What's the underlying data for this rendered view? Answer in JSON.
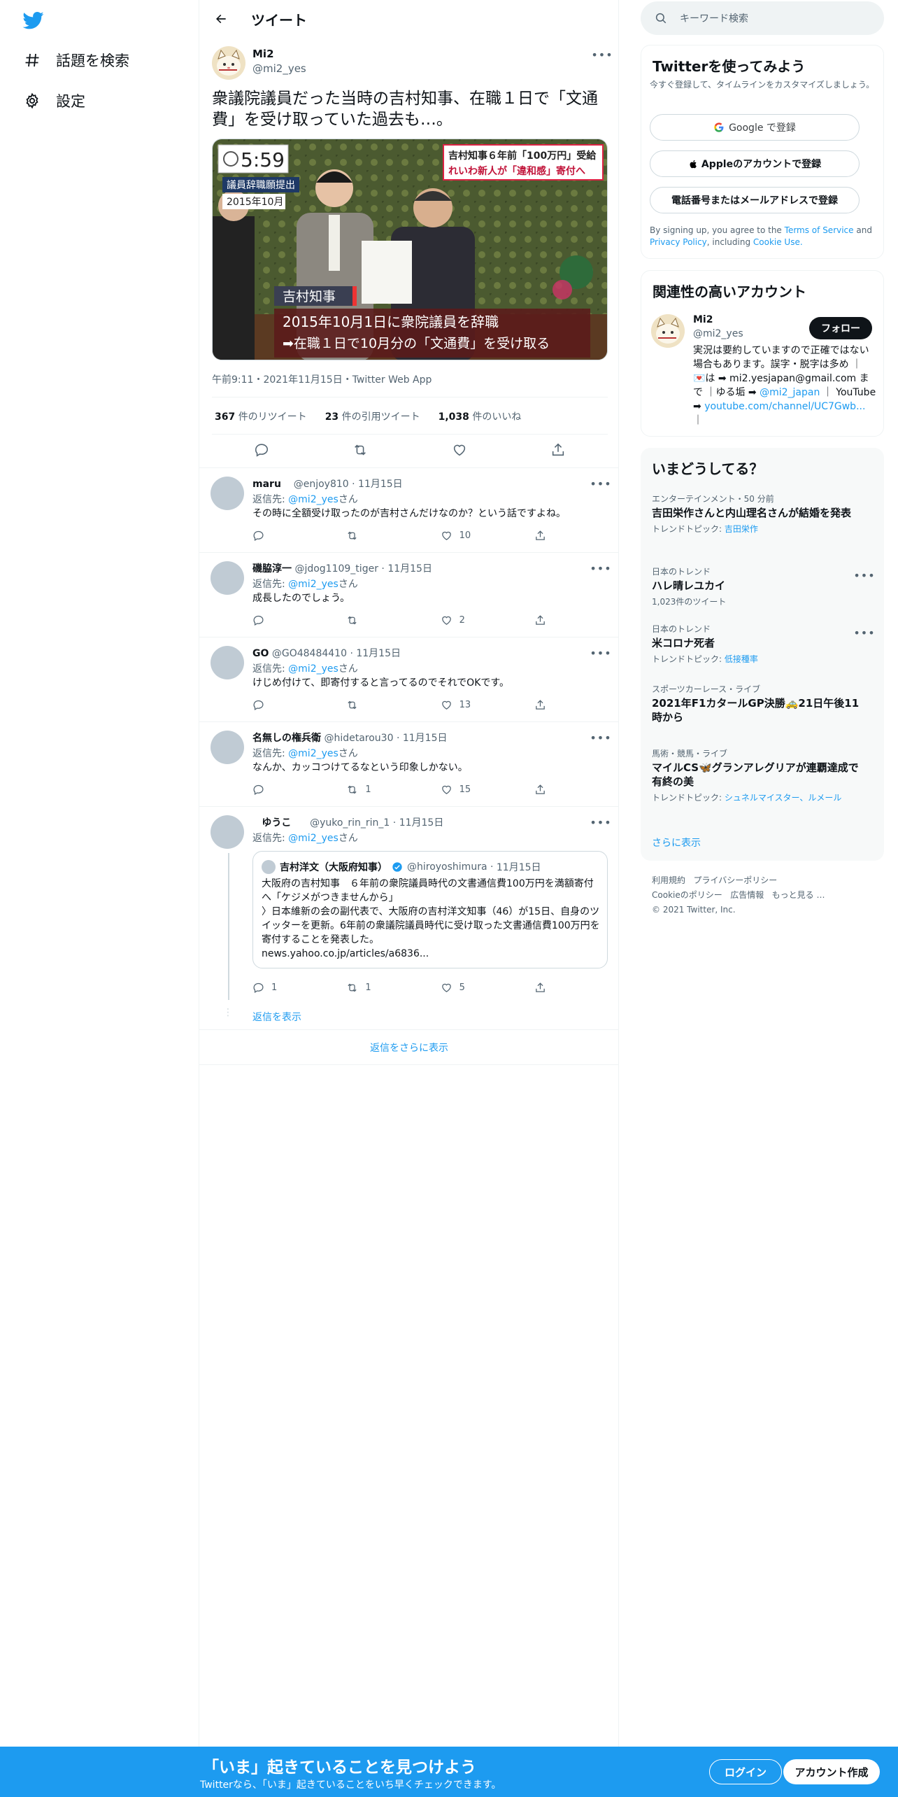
{
  "nav": {
    "explore_label": "話題を検索",
    "settings_label": "設定"
  },
  "header": {
    "title": "ツイート"
  },
  "tweet": {
    "name": "Mi2",
    "handle": "@mi2_yes",
    "text": "衆議院議員だった当時の吉村知事、在職１日で「文通費」を受け取っていた過去も…。",
    "image": {
      "clock": "5:59",
      "tag1": "議員辞職願提出",
      "tag2": "2015年10月",
      "headline1": "吉村知事６年前「100万円」受給",
      "headline2": "れいわ新人が「違和感」寄付へ",
      "name_caption": "吉村知事",
      "caption1": "2015年10月1日に衆院議員を辞職",
      "caption2": "➡在職１日で10月分の「文通費」を受け取る"
    },
    "meta": "午前9:11・2021年11月15日・Twitter Web App",
    "retweets": "367",
    "retweets_label": "件のリツイート",
    "quotes": "23",
    "quotes_label": "件の引用ツイート",
    "likes": "1,038",
    "likes_label": "件のいいね"
  },
  "reply_to_label": "返信先:",
  "reply_to_user": "@mi2_yes",
  "reply_to_suffix": "さん",
  "replies": [
    {
      "name": "maru",
      "handle": "@enjoy810",
      "date": "11月15日",
      "text": "その時に全額受け取ったのが吉村さんだけなのか？という話ですよね。",
      "reply": "",
      "retweet": "",
      "like": "10"
    },
    {
      "name": "磯脇淳一",
      "handle": "@jdog1109_tiger",
      "date": "11月15日",
      "text": "成長したのでしょう。",
      "reply": "",
      "retweet": "",
      "like": "2"
    },
    {
      "name": "GO",
      "handle": "@GO48484410",
      "date": "11月15日",
      "text": "けじめ付けて、即寄付すると言ってるのでそれでOKです。",
      "reply": "",
      "retweet": "",
      "like": "13"
    },
    {
      "name": "名無しの権兵衛",
      "handle": "@hidetarou30",
      "date": "11月15日",
      "text": "なんか、カッコつけてるなという印象しかない。",
      "reply": "",
      "retweet": "1",
      "like": "15"
    },
    {
      "name": "ゆうこ",
      "handle": "@yuko_rin_rin_1",
      "date": "11月15日",
      "text": "",
      "reply": "1",
      "retweet": "1",
      "like": "5"
    }
  ],
  "quote": {
    "name": "吉村洋文（大阪府知事）",
    "handle": "@hiroyoshimura",
    "date": "11月15日",
    "line1": "大阪府の吉村知事　６年前の衆院議員時代の文書通信費100万円を満額寄付へ「ケジメがつきませんから」",
    "line2": "〉日本維新の会の副代表で、大阪府の吉村洋文知事（46）が15日、自身のツイッターを更新。6年前の衆議院議員時代に受け取った文書通信費100万円を寄付することを発表した。",
    "line3": "news.yahoo.co.jp/articles/a6836..."
  },
  "show_replies": "返信を表示",
  "show_more_replies": "返信をさらに表示",
  "search": {
    "placeholder": "キーワード検索"
  },
  "signup_card": {
    "title": "Twitterを使ってみよう",
    "subtitle": "今すぐ登録して、タイムラインをカスタマイズしましょう。",
    "google": "Google で登録",
    "apple": "Appleのアカウントで登録",
    "phone": "電話番号またはメールアドレスで登録",
    "terms_prefix": "By signing up, you agree to the",
    "terms": "Terms of Service",
    "and": "and",
    "privacy": "Privacy Policy",
    "including": ", including",
    "cookie": "Cookie Use."
  },
  "related": {
    "title": "関連性の高いアカウント",
    "name": "Mi2",
    "handle": "@mi2_yes",
    "follow": "フォロー",
    "bio1": "実況は要約していますので正確ではない場合もあります。誤字・脱字は多め ｜ 💌は ➡ mi2.yesjapan@gmail.com まで ｜ゆる垢 ➡",
    "bio_link1": "@mi2_japan",
    "bio2": "｜ YouTube ➡",
    "bio_link2": "youtube.com/channel/UC7Gwb...",
    "bio3": "｜"
  },
  "trends": {
    "title": "いまどうしてる？",
    "items": [
      {
        "context": "エンターテインメント・50 分前",
        "title": "吉田栄作さんと内山理名さんが結婚を発表",
        "sub_label": "トレンドトピック:",
        "sub_link": "吉田栄作"
      },
      {
        "context": "日本のトレンド",
        "title": "ハレ晴レユカイ",
        "sub_label": "1,023件のツイート",
        "sub_link": ""
      },
      {
        "context": "日本のトレンド",
        "title": "米コロナ死者",
        "sub_label": "トレンドトピック:",
        "sub_link": "低接種率"
      },
      {
        "context": "スポーツカーレース・ライブ",
        "title": "2021年F1カタールGP決勝🚕21日午後11時から",
        "sub_label": "",
        "sub_link": ""
      },
      {
        "context": "馬術・競馬・ライブ",
        "title": "マイルCS🦋グランアレグリアが連覇達成で有終の美",
        "sub_label": "トレンドトピック:",
        "sub_link": "シュネルマイスター、ルメール"
      }
    ],
    "show_more": "さらに表示"
  },
  "footer": {
    "terms": "利用規約",
    "privacy": "プライバシーポリシー",
    "cookie": "Cookieのポリシー",
    "ads": "広告情報",
    "more": "もっと見る …",
    "copyright": "© 2021 Twitter, Inc."
  },
  "bottom": {
    "headline": "「いま」起きていることを見つけよう",
    "sub": "Twitterなら、「いま」起きていることをいち早くチェックできます。",
    "login": "ログイン",
    "signup": "アカウント作成"
  },
  "colors": {
    "accent": "#1d9bf0",
    "text": "#0f1419",
    "secondary": "#536471"
  }
}
